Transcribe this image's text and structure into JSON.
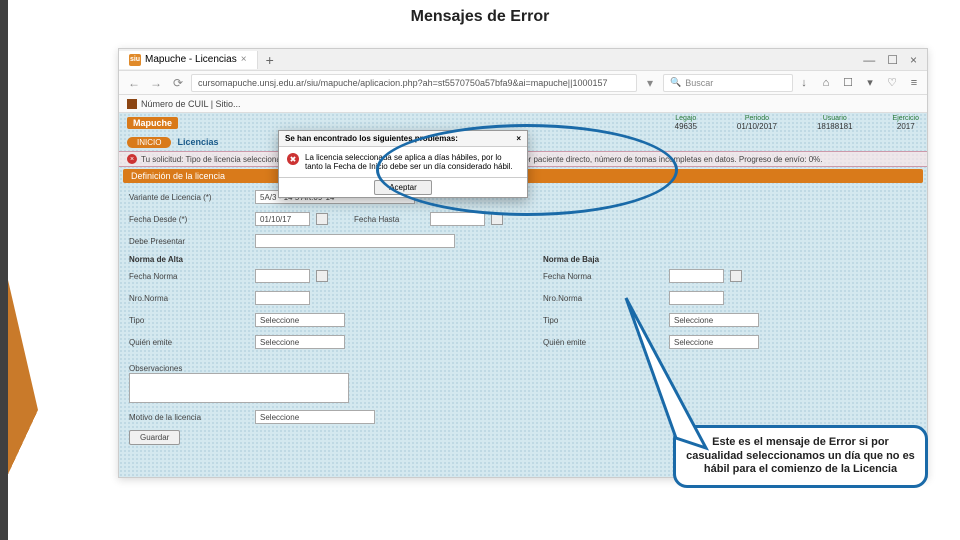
{
  "slide": {
    "title": "Mensajes de Error"
  },
  "browser": {
    "tab_title": "Mapuche - Licencias",
    "url": "cursomapuche.unsj.edu.ar/siu/mapuche/aplicacion.php?ah=st5570750a57bfa9&ai=mapuche||1000157",
    "search_placeholder": "Buscar",
    "bookmark": "Número de CUIL | Sitio..."
  },
  "app": {
    "logo": "Mapuche",
    "header": {
      "legajo_lbl": "Legajo",
      "legajo_val": "49635",
      "periodo_lbl": "Periodo",
      "periodo_val": "01/10/2017",
      "usuario_lbl": "Usuario",
      "usuario_val": "18188181",
      "ejercicio_lbl": "Ejercicio",
      "ejercicio_val": "2017"
    },
    "crumb_tag": "INICIO",
    "crumb_sel": "Licencias",
    "err_strip": "Tu solicitud: Tipo de licencia seleccionada: 5A/3: 14 5 Artículo 09° 14 : Falta por razón Particular. Certificar por paciente directo, número de tomas incompletas en datos. Progreso de envío: 0%.",
    "section": "Definición de la licencia",
    "form": {
      "variante_lbl": "Variante de Licencia (*)",
      "variante_val": "5A/3 - 14 5 Art.09°14",
      "fecha_desde_lbl": "Fecha Desde (*)",
      "fecha_desde_val": "01/10/17",
      "fecha_hasta_lbl": "Fecha Hasta",
      "debe_presentar_lbl": "Debe Presentar",
      "alta_title": "Norma de Alta",
      "baja_title": "Norma de Baja",
      "fecha_norma_lbl": "Fecha Norma",
      "nro_norma_lbl": "Nro.Norma",
      "tipo_lbl": "Tipo",
      "tipo_val": "Seleccione",
      "emite_lbl": "Quién emite",
      "emite_val": "Seleccione",
      "obs_lbl": "Observaciones",
      "motivo_lbl": "Motivo de la licencia",
      "motivo_val": "Seleccione",
      "guardar": "Guardar"
    }
  },
  "modal": {
    "title": "Se han encontrado los siguientes problemas:",
    "msg": "La licencia seleccionada se aplica a días hábiles, por lo tanto la Fecha de Inicio debe ser un día considerado hábil.",
    "ok": "Aceptar"
  },
  "callout": "Este es el mensaje de Error si por casualidad seleccionamos un día que no es hábil para el comienzo de la Licencia"
}
